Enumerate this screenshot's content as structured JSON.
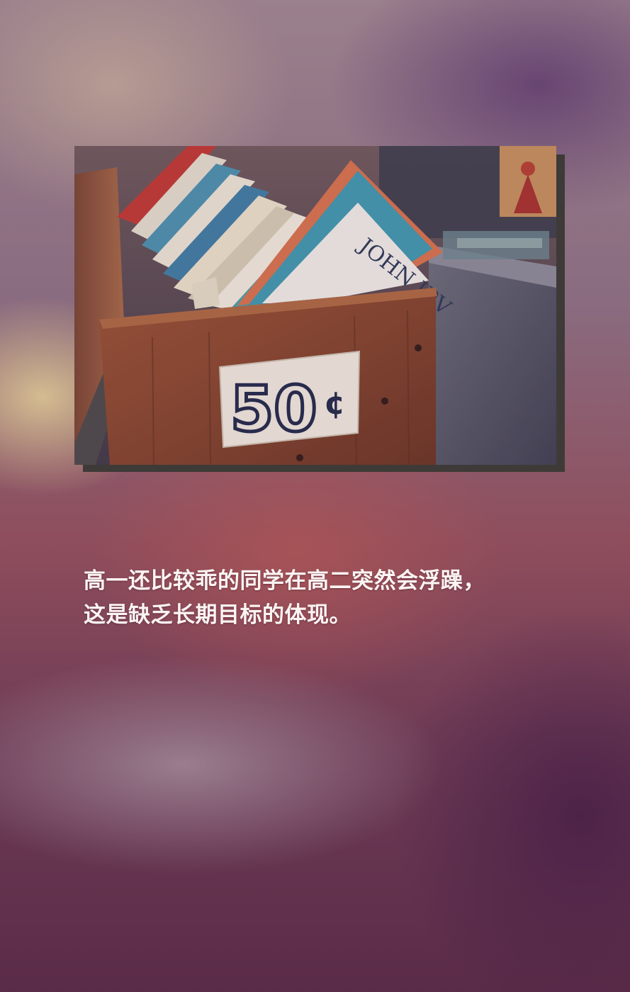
{
  "photo": {
    "price_label": "50",
    "price_unit": "¢",
    "book_spine_text": "JOHN IRV"
  },
  "caption": {
    "lines": [
      "高一还比较乖的同学在高二突然会浮躁，",
      "这是缺乏长期目标的体现。"
    ]
  },
  "colors": {
    "caption_text": "#fbf4f2",
    "photo_shadow": "#3e3a37",
    "crate_wood": "#8a4a2c"
  }
}
